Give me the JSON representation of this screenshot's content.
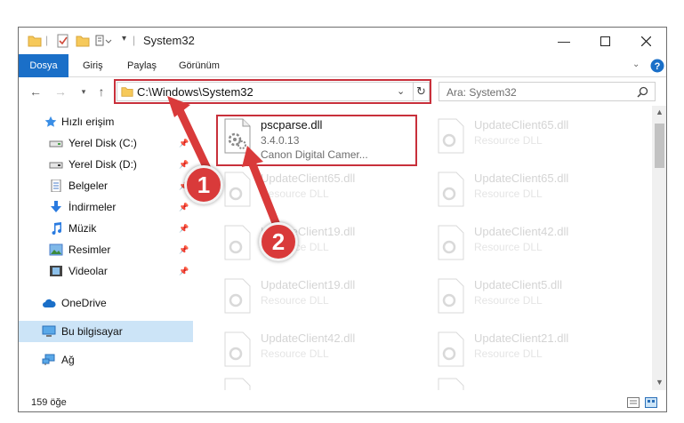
{
  "window": {
    "title": "System32"
  },
  "ribbon": {
    "tabs": [
      "Dosya",
      "Giriş",
      "Paylaş",
      "Görünüm"
    ]
  },
  "address": {
    "path": "C:\\Windows\\System32",
    "search_placeholder": "Ara: System32"
  },
  "sidebar": {
    "items": [
      {
        "label": "Hızlı erişim",
        "icon": "star-icon"
      },
      {
        "label": "Yerel Disk (C:)",
        "icon": "drive-icon"
      },
      {
        "label": "Yerel Disk (D:)",
        "icon": "drive-icon"
      },
      {
        "label": "Belgeler",
        "icon": "documents-icon"
      },
      {
        "label": "İndirmeler",
        "icon": "download-icon"
      },
      {
        "label": "Müzik",
        "icon": "music-icon"
      },
      {
        "label": "Resimler",
        "icon": "pictures-icon"
      },
      {
        "label": "Videolar",
        "icon": "videos-icon"
      },
      {
        "label": "OneDrive",
        "icon": "cloud-icon"
      },
      {
        "label": "Bu bilgisayar",
        "icon": "computer-icon"
      },
      {
        "label": "Ağ",
        "icon": "network-icon"
      }
    ]
  },
  "files": {
    "primary": {
      "name": "pscparse.dll",
      "version": "3.4.0.13",
      "company": "Canon Digital Camer..."
    },
    "faded": [
      {
        "name": "UpdateClient65.dll",
        "desc": "Resource DLL"
      },
      {
        "name": "UpdateClient65.dll",
        "desc": "Resource DLL"
      },
      {
        "name": "UpdateClient65.dll",
        "desc": "Resource DLL"
      },
      {
        "name": "UpdateClient19.dll",
        "desc": "Resource DLL"
      },
      {
        "name": "UpdateClient42.dll",
        "desc": "Resource DLL"
      },
      {
        "name": "UpdateClient19.dll",
        "desc": "Resource DLL"
      },
      {
        "name": "UpdateClient5.dll",
        "desc": "Resource DLL"
      },
      {
        "name": "UpdateClient42.dll",
        "desc": "Resource DLL"
      },
      {
        "name": "UpdateClient21.dll",
        "desc": "Resource DLL"
      }
    ]
  },
  "status": {
    "count": "159 öğe"
  },
  "callouts": {
    "one": "1",
    "two": "2"
  },
  "colors": {
    "accent": "#1a6fc8",
    "highlight": "#c8303b",
    "badge": "#d93a3a",
    "selected": "#cce4f7"
  }
}
